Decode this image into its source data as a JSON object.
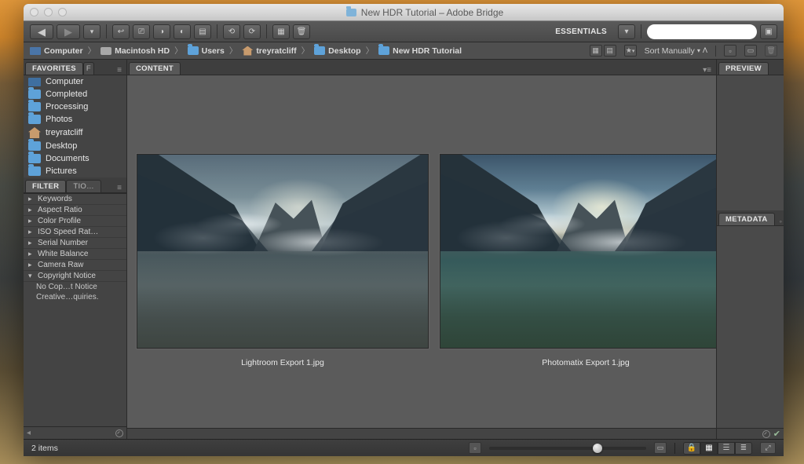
{
  "title": "New HDR Tutorial – Adobe Bridge",
  "toolbar": {
    "workspace_label": "ESSENTIALS"
  },
  "breadcrumb": [
    {
      "icon": "comp",
      "label": "Computer"
    },
    {
      "icon": "hd",
      "label": "Macintosh HD"
    },
    {
      "icon": "folder",
      "label": "Users"
    },
    {
      "icon": "home",
      "label": "treyratcliff"
    },
    {
      "icon": "folder",
      "label": "Desktop"
    },
    {
      "icon": "folder",
      "label": "New HDR Tutorial"
    }
  ],
  "sort_label": "Sort Manually",
  "favorites_tab": "FAVORITES",
  "favorites": [
    {
      "icon": "comp",
      "label": "Computer"
    },
    {
      "icon": "folder",
      "label": "Completed"
    },
    {
      "icon": "folder",
      "label": "Processing"
    },
    {
      "icon": "folder",
      "label": "Photos"
    },
    {
      "icon": "home",
      "label": "treyratcliff"
    },
    {
      "icon": "folder",
      "label": "Desktop"
    },
    {
      "icon": "folder",
      "label": "Documents"
    },
    {
      "icon": "folder",
      "label": "Pictures"
    }
  ],
  "filter_tab_a": "FILTER",
  "filter_tab_b": "TIO…",
  "filters": [
    "Keywords",
    "Aspect Ratio",
    "Color Profile",
    "ISO Speed Rat…",
    "Serial Number",
    "White Balance",
    "Camera Raw"
  ],
  "filter_open": {
    "label": "Copyright Notice",
    "items": [
      "No Cop…t Notice",
      "Creative…quiries."
    ]
  },
  "content_tab": "CONTENT",
  "preview_tab": "PREVIEW",
  "metadata_tab": "METADATA",
  "thumbs": [
    {
      "name": "Lightroom Export 1.jpg"
    },
    {
      "name": "Photomatix Export 1.jpg"
    }
  ],
  "status": {
    "count_label": "2 items",
    "slider_pct": 70
  }
}
